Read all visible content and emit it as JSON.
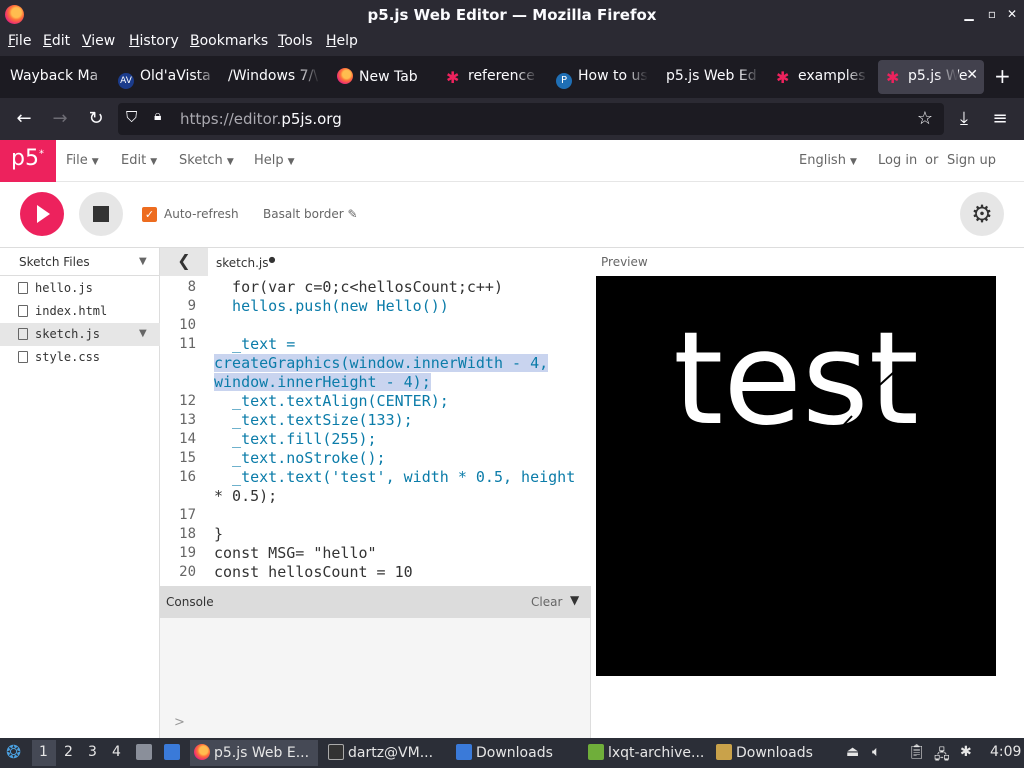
{
  "window": {
    "title": "p5.js Web Editor — Mozilla Firefox"
  },
  "menubar": {
    "items": [
      "File",
      "Edit",
      "View",
      "History",
      "Bookmarks",
      "Tools",
      "Help"
    ]
  },
  "tabs": [
    {
      "label": "Wayback Ma",
      "icon": "none"
    },
    {
      "label": "Old'aVista",
      "icon": "av-icon"
    },
    {
      "label": "/Windows 7/\\",
      "icon": "none"
    },
    {
      "label": "New Tab",
      "icon": "firefox-icon"
    },
    {
      "label": "reference",
      "icon": "p5-star-icon"
    },
    {
      "label": "How to us",
      "icon": "p-icon"
    },
    {
      "label": "p5.js Web Ed",
      "icon": "none"
    },
    {
      "label": "examples",
      "icon": "p5-star-icon"
    },
    {
      "label": "p5.js We",
      "icon": "p5-star-icon",
      "active": true
    }
  ],
  "navbar": {
    "url_prefix": "https://editor.",
    "url_domain": "p5js.org"
  },
  "p5": {
    "logo": "p5",
    "logo_sup": "*",
    "menu": [
      "File",
      "Edit",
      "Sketch",
      "Help"
    ],
    "language": "English",
    "login": "Log in",
    "or": "or",
    "signup": "Sign up",
    "autorefresh_label": "Auto-refresh",
    "autorefresh_checked": true,
    "sketch_name": "Basalt border",
    "accent_color": "#ed225d"
  },
  "sidebar": {
    "title": "Sketch Files",
    "files": [
      {
        "name": "hello.js",
        "selected": false
      },
      {
        "name": "index.html",
        "selected": false
      },
      {
        "name": "sketch.js",
        "selected": true
      },
      {
        "name": "style.css",
        "selected": false
      }
    ]
  },
  "editor": {
    "filename": "sketch.js",
    "line_numbers": [
      "8",
      "9",
      "10",
      "11",
      "12",
      "13",
      "14",
      "15",
      "16",
      "17",
      "18",
      "19",
      "20"
    ],
    "lines": {
      "l8": "  for(var c=0;c<hellosCount;c++)",
      "l9": "  hellos.push(new Hello())",
      "l11a": "  _text =",
      "l11b": "createGraphics(window.innerWidth - 4,",
      "l11c": "window.innerHeight - 4);",
      "l12": "  _text.textAlign(CENTER);",
      "l13": "  _text.textSize(133);",
      "l14": "  _text.fill(255);",
      "l15": "  _text.noStroke();",
      "l16a": "  _text.text('test', width * 0.5, height",
      "l16b": "* 0.5);",
      "l18": "}",
      "l19": "const MSG= \"hello\"",
      "l20": "const hellosCount = 10"
    }
  },
  "console": {
    "title": "Console",
    "clear": "Clear",
    "prompt": ">"
  },
  "preview": {
    "label": "Preview",
    "canvas_text": "test"
  },
  "taskbar": {
    "workspaces": [
      "1",
      "2",
      "3",
      "4"
    ],
    "tasks": [
      {
        "label": "p5.js Web E...",
        "icon": "firefox-icon",
        "active": true
      },
      {
        "label": "dartz@VM...",
        "icon": "terminal-icon"
      },
      {
        "label": "Downloads",
        "icon": "folder-icon"
      },
      {
        "label": "lxqt-archive...",
        "icon": "archive-icon"
      },
      {
        "label": "Downloads",
        "icon": "folder-icon"
      }
    ],
    "clock": "4:09"
  }
}
